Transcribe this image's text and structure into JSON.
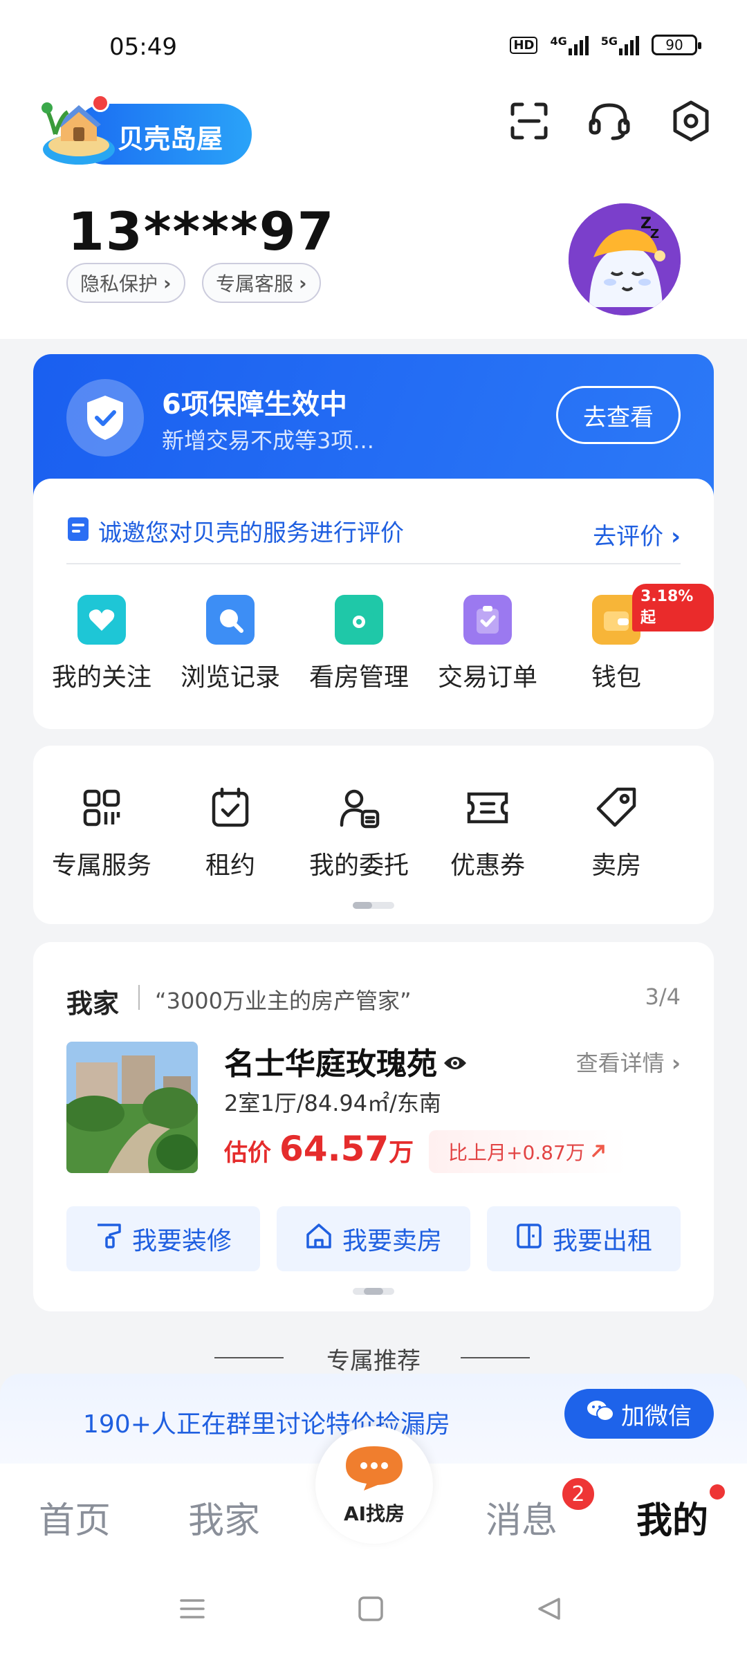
{
  "status_bar": {
    "time": "05:49",
    "hd": "HD",
    "net1": "4G",
    "net2": "5G",
    "battery": "90"
  },
  "header": {
    "island_label": "贝壳岛屋",
    "icons": [
      "scan-icon",
      "headset-icon",
      "settings-icon"
    ]
  },
  "profile": {
    "phone": "13****97",
    "privacy_chip": "隐私保护",
    "service_chip": "专属客服"
  },
  "guarantee": {
    "title": "6项保障生效中",
    "subtitle": "新增交易不成等3项...",
    "button": "去查看"
  },
  "review": {
    "text": "诚邀您对贝壳的服务进行评价",
    "link": "去评价"
  },
  "shortcuts": [
    {
      "label": "我的关注",
      "icon": "heart-icon",
      "color": "#1ec6d6"
    },
    {
      "label": "浏览记录",
      "icon": "search-icon",
      "color": "#3d8ef5"
    },
    {
      "label": "看房管理",
      "icon": "folder-icon",
      "color": "#1fc8a8"
    },
    {
      "label": "交易订单",
      "icon": "clipboard-check-icon",
      "color": "#9b79f0"
    },
    {
      "label": "钱包",
      "icon": "wallet-icon",
      "color": "#f7b538"
    }
  ],
  "wallet_badge": "3.18%起",
  "services": [
    {
      "label": "专属服务",
      "icon": "grid-icon"
    },
    {
      "label": "租约",
      "icon": "calendar-check-icon"
    },
    {
      "label": "我的委托",
      "icon": "person-card-icon"
    },
    {
      "label": "优惠券",
      "icon": "coupon-icon"
    },
    {
      "label": "卖房",
      "icon": "tag-icon"
    }
  ],
  "my_home": {
    "title": "我家",
    "slogan": "“3000万业主的房产管家”",
    "page": "3/4",
    "name": "名士华庭玫瑰苑",
    "detail_link": "查看详情",
    "spec": "2室1厅/84.94㎡/东南",
    "price_label": "估价",
    "price_value": "64.57",
    "price_unit": "万",
    "change": "比上月+0.87万",
    "actions": [
      "我要装修",
      "我要卖房",
      "我要出租"
    ]
  },
  "recommend_title": "专属推荐",
  "wechat": {
    "text": "190+人正在群里讨论特价捡漏房",
    "button": "加微信"
  },
  "bottom_nav": {
    "home": "首页",
    "my_home": "我家",
    "ai": "AI找房",
    "messages": "消息",
    "messages_badge": "2",
    "mine": "我的"
  },
  "colors": {
    "brand_blue": "#1f5fe0",
    "price_red": "#e52c2c"
  }
}
